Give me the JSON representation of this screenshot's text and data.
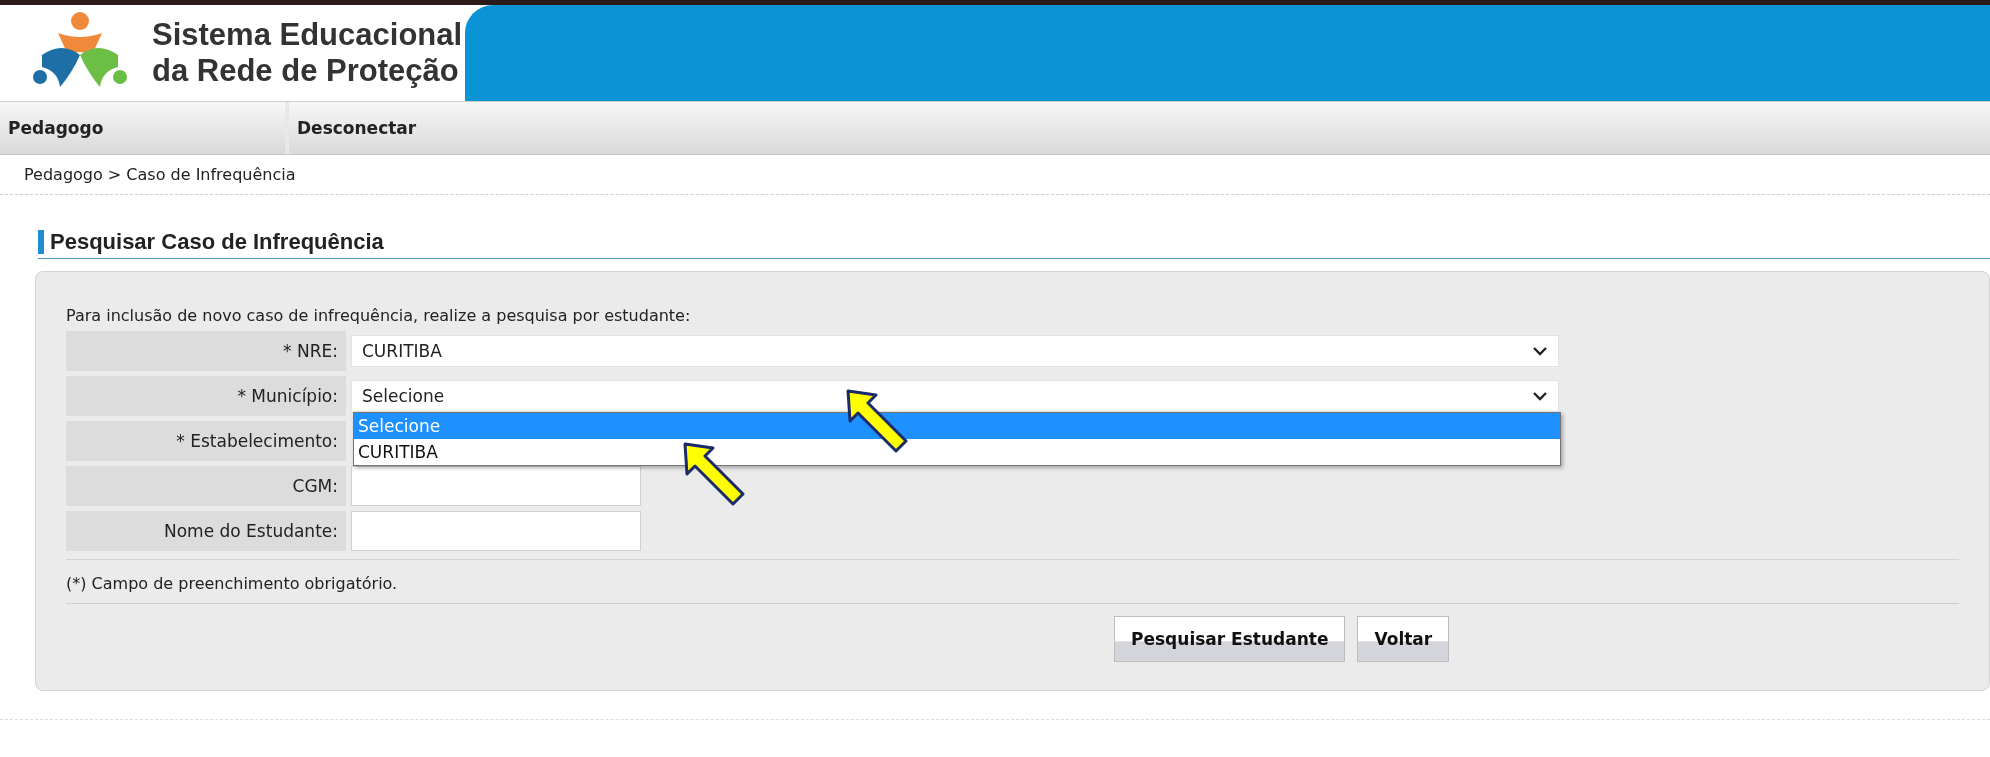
{
  "header": {
    "title_lines": [
      "Sistema Educacional",
      "da Rede de Proteção"
    ]
  },
  "nav": [
    {
      "label": "Pedagogo"
    },
    {
      "label": "Desconectar"
    }
  ],
  "breadcrumb": "Pedagogo > Caso de Infrequência",
  "page_title": "Pesquisar Caso de Infrequência",
  "form": {
    "intro": "Para inclusão de novo caso de infrequência, realize a pesquisa por estudante:",
    "fields": [
      {
        "kind": "select",
        "label": "* NRE:",
        "value": "CURITIBA",
        "expanded": false
      },
      {
        "kind": "select",
        "label": "* Município:",
        "value": "Selecione",
        "expanded": true,
        "options": [
          {
            "label": "Selecione",
            "selected": true
          },
          {
            "label": "CURITIBA",
            "selected": false
          }
        ]
      },
      {
        "kind": "covered",
        "label": "* Estabelecimento:"
      },
      {
        "kind": "text",
        "label": "CGM:"
      },
      {
        "kind": "text",
        "label": "Nome do Estudante:"
      }
    ],
    "note": "(*) Campo de preenchimento obrigatório.",
    "buttons": [
      "Pesquisar Estudante",
      "Voltar"
    ]
  }
}
